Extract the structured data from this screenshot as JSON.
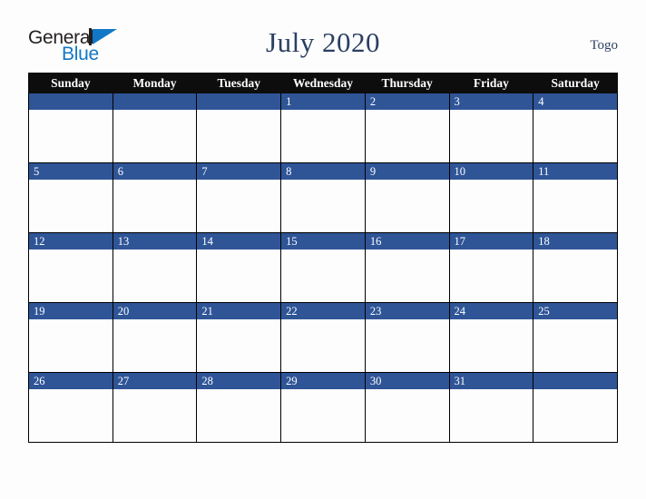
{
  "brand": {
    "name_part1": "General",
    "name_part2": "Blue"
  },
  "header": {
    "title": "July 2020",
    "region": "Togo"
  },
  "calendar": {
    "weekday_headers": [
      "Sunday",
      "Monday",
      "Tuesday",
      "Wednesday",
      "Thursday",
      "Friday",
      "Saturday"
    ],
    "accent_color": "#2f5597",
    "header_bg_color": "#0d0d0d",
    "title_color": "#2b3f63",
    "weeks": [
      [
        {
          "day": "",
          "has_bar": true
        },
        {
          "day": "",
          "has_bar": true
        },
        {
          "day": "",
          "has_bar": true
        },
        {
          "day": "1",
          "has_bar": true
        },
        {
          "day": "2",
          "has_bar": true
        },
        {
          "day": "3",
          "has_bar": true
        },
        {
          "day": "4",
          "has_bar": true
        }
      ],
      [
        {
          "day": "5",
          "has_bar": true
        },
        {
          "day": "6",
          "has_bar": true
        },
        {
          "day": "7",
          "has_bar": true
        },
        {
          "day": "8",
          "has_bar": true
        },
        {
          "day": "9",
          "has_bar": true
        },
        {
          "day": "10",
          "has_bar": true
        },
        {
          "day": "11",
          "has_bar": true
        }
      ],
      [
        {
          "day": "12",
          "has_bar": true
        },
        {
          "day": "13",
          "has_bar": true
        },
        {
          "day": "14",
          "has_bar": true
        },
        {
          "day": "15",
          "has_bar": true
        },
        {
          "day": "16",
          "has_bar": true
        },
        {
          "day": "17",
          "has_bar": true
        },
        {
          "day": "18",
          "has_bar": true
        }
      ],
      [
        {
          "day": "19",
          "has_bar": true
        },
        {
          "day": "20",
          "has_bar": true
        },
        {
          "day": "21",
          "has_bar": true
        },
        {
          "day": "22",
          "has_bar": true
        },
        {
          "day": "23",
          "has_bar": true
        },
        {
          "day": "24",
          "has_bar": true
        },
        {
          "day": "25",
          "has_bar": true
        }
      ],
      [
        {
          "day": "26",
          "has_bar": true
        },
        {
          "day": "27",
          "has_bar": true
        },
        {
          "day": "28",
          "has_bar": true
        },
        {
          "day": "29",
          "has_bar": true
        },
        {
          "day": "30",
          "has_bar": true
        },
        {
          "day": "31",
          "has_bar": true
        },
        {
          "day": "",
          "has_bar": true
        }
      ]
    ]
  }
}
